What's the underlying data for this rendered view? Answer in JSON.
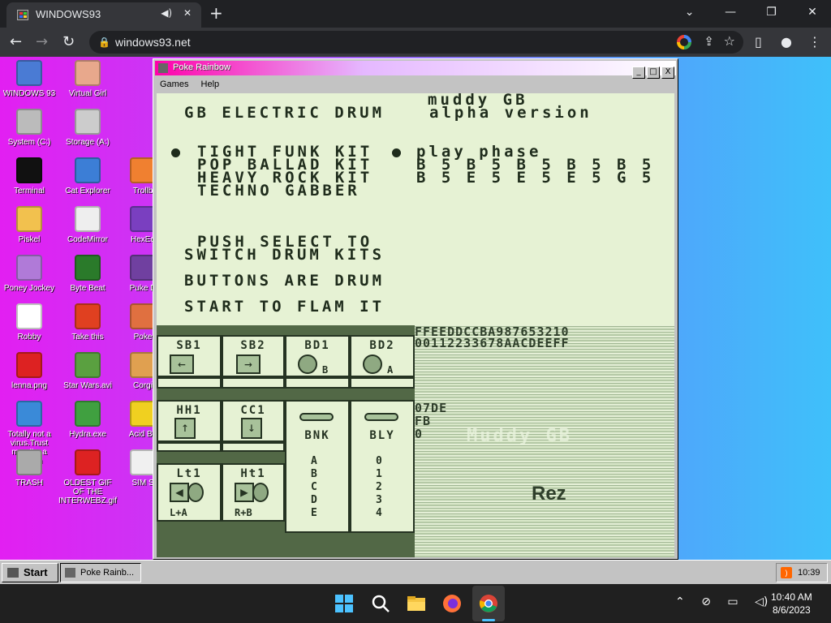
{
  "browser": {
    "tab_title": "WINDOWS93",
    "url": "windows93.net",
    "new_tab": "+",
    "tab_icons": {
      "mute": "◀)",
      "close": "✕"
    },
    "window_controls": {
      "list": "⌄",
      "minimize": "—",
      "restore": "❐",
      "close": "✕"
    },
    "nav": {
      "back": "←",
      "forward": "→",
      "reload": "↻"
    },
    "omni_icons": {
      "lock": "🔒",
      "share": "⇪",
      "star": "☆"
    },
    "toolbar_icons": {
      "sidebar": "▯",
      "profile": "●",
      "menu": "⋮"
    }
  },
  "desktop_icons": [
    {
      "label": "WINDOWS 93",
      "icon": "computer-icon",
      "color": "#4a7bd4"
    },
    {
      "label": "Virtual Girl",
      "icon": "face-icon",
      "color": "#e8a88c"
    },
    {
      "label": "System (C:)",
      "icon": "drive-icon",
      "color": "#bbbbbb"
    },
    {
      "label": "Storage (A:)",
      "icon": "floppy-drive-icon",
      "color": "#cccccc"
    },
    {
      "label": "Terminal",
      "icon": "terminal-icon",
      "color": "#111111"
    },
    {
      "label": "Cat Explorer",
      "icon": "globe-cat-icon",
      "color": "#3c7ed6"
    },
    {
      "label": "Trollb",
      "icon": "troll-icon",
      "color": "#f08030"
    },
    {
      "label": "Piskel",
      "icon": "palette-icon",
      "color": "#f2c14e"
    },
    {
      "label": "CodeMirror",
      "icon": "codemirror-icon",
      "color": "#eeeeee"
    },
    {
      "label": "HexEd",
      "icon": "hex-icon",
      "color": "#7a3fc0"
    },
    {
      "label": "Poney Jockey",
      "icon": "pony-icon",
      "color": "#b07ad8"
    },
    {
      "label": "Byte Beat",
      "icon": "bytebeat-icon",
      "color": "#2a7a2a"
    },
    {
      "label": "Puke D",
      "icon": "puke-icon",
      "color": "#7040a0"
    },
    {
      "label": "Robby",
      "icon": "stickman-icon",
      "color": "#ffffff"
    },
    {
      "label": "Take this",
      "icon": "sprite-icon",
      "color": "#e04020"
    },
    {
      "label": "Poke",
      "icon": "poke-icon",
      "color": "#e07040"
    },
    {
      "label": "lenna.png",
      "icon": "png-file-icon",
      "color": "#dd2222"
    },
    {
      "label": "Star Wars.avi",
      "icon": "yoda-icon",
      "color": "#5aa040"
    },
    {
      "label": "Corgi",
      "icon": "corgi-icon",
      "color": "#e0a050"
    },
    {
      "label": "Totally not a virus.Trust me...I'm a dolphin",
      "icon": "dolphin-icon",
      "color": "#3a8ad8"
    },
    {
      "label": "Hydra.exe",
      "icon": "hydra-icon",
      "color": "#40a040"
    },
    {
      "label": "Acid Bo",
      "icon": "smiley-icon",
      "color": "#f0d020"
    },
    {
      "label": "TRASH",
      "icon": "trash-icon",
      "color": "#aaaaaa"
    },
    {
      "label": "OLDEST GIF OF THE INTERWEBZ.gif",
      "icon": "gif-file-icon",
      "color": "#dd2222"
    },
    {
      "label": "SIM S",
      "icon": "sim-icon",
      "color": "#f0f0f0"
    }
  ],
  "window": {
    "title": "Poke Rainbow",
    "menu": [
      "Games",
      "Help"
    ],
    "controls": {
      "minimize": "_",
      "maximize": "□",
      "close": "X"
    }
  },
  "game": {
    "header_left": "GB ELECTRIC DRUM",
    "header_right_1": "muddy GB",
    "header_right_2": "alpha version",
    "kits": [
      "TIGHT FUNK KIT",
      "POP BALLAD KIT",
      "HEAVY ROCK KIT",
      "TECHNO GABBER"
    ],
    "phase_label": "play phase",
    "pattern_rows": [
      "B 5 B 5 B 5 B 5 B 5",
      "B 5 E 5 E 5 E 5 G 5"
    ],
    "instructions": [
      "PUSH SELECT TO",
      "SWITCH DRUM KITS",
      "BUTTONS ARE DRUM",
      "START TO FLAM IT"
    ],
    "pads": {
      "sb1": "SB1",
      "sb2": "SB2",
      "bd1": "BD1",
      "bd2": "BD2",
      "hh1": "HH1",
      "cc1": "CC1",
      "bnk": "BNK",
      "bly": "BLY",
      "lt1": "Lt1",
      "ht1": "Ht1",
      "lt1_combo": "L+A",
      "ht1_combo": "R+B",
      "bd1_sub": "B",
      "bd2_sub": "A",
      "bnk_col": "A\nB\nC\nD\nE",
      "bly_col": "0\n1\n2\n3\n4",
      "arrows": {
        "left": "←",
        "right": "→",
        "up": "↑",
        "down": "↓",
        "lt": "◀",
        "ht": "▶"
      }
    },
    "hex_rows": [
      "FFEEDDCCBA987653210",
      "00112233678AACDEEFF"
    ],
    "hex_mid": [
      "07DE",
      "FB",
      "0"
    ],
    "ghost_text": "Muddy GB",
    "rez_text": "Rez"
  },
  "taskbar93": {
    "start": "Start",
    "item": "Poke Rainb...",
    "clock": "10:39",
    "rss_glyph": ")"
  },
  "win11": {
    "time": "10:40 AM",
    "date": "8/6/2023",
    "pinned": [
      "windows-start-icon",
      "search-icon",
      "file-explorer-icon",
      "firefox-icon",
      "chrome-icon"
    ],
    "tray": {
      "chevron": "⌃",
      "network": "⊘",
      "display": "▭",
      "volume": "◁)"
    }
  }
}
